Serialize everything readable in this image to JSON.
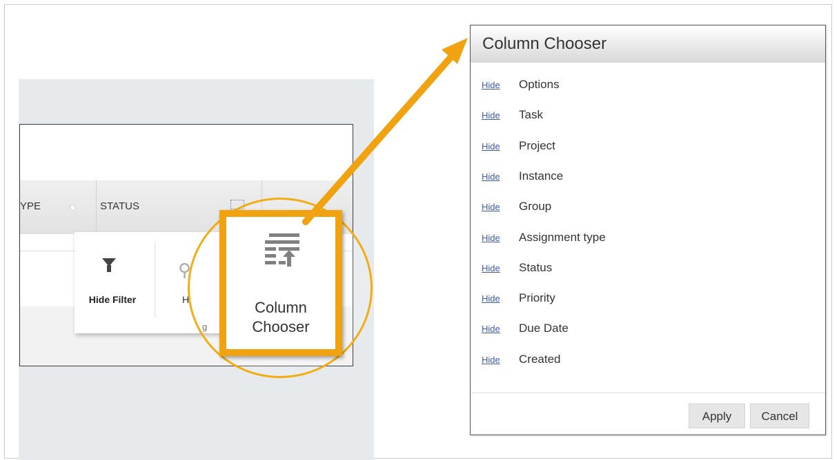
{
  "grid": {
    "col_type_partial": "YPE",
    "col_status": "STATUS"
  },
  "popup": {
    "hide_filter_label": "Hide Filter",
    "partial_label": "H",
    "partial_bottom_text": "g"
  },
  "highlight": {
    "column_chooser_label_line1": "Column",
    "column_chooser_label_line2": "Chooser"
  },
  "dialog": {
    "title": "Column Chooser",
    "hide_label": "Hide",
    "columns": [
      "Options",
      "Task",
      "Project",
      "Instance",
      "Group",
      "Assignment type",
      "Status",
      "Priority",
      "Due Date",
      "Created"
    ],
    "apply_label": "Apply",
    "cancel_label": "Cancel"
  },
  "colors": {
    "accent_orange": "#f0a210",
    "link_blue": "#3b5bb0"
  },
  "icons": [
    "funnel-icon",
    "column-chooser-icon",
    "gear-icon",
    "callout-arrow"
  ]
}
